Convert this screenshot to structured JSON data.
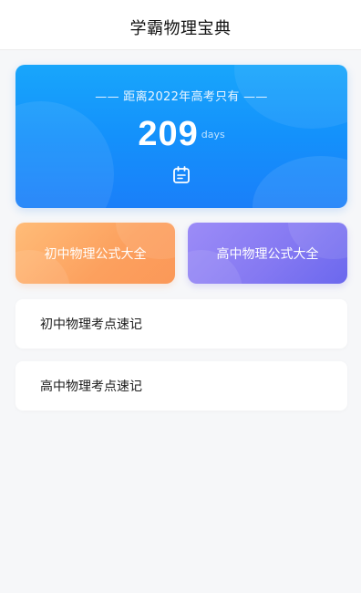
{
  "header": {
    "title": "学霸物理宝典"
  },
  "countdown": {
    "caption": "—— 距离2022年高考只有 ——",
    "days": "209",
    "unit": "days",
    "icon": "calendar-icon",
    "gradient_top": "#18a6fb",
    "gradient_bottom": "#1a7ff9"
  },
  "formula_buttons": [
    {
      "label": "初中物理公式大全",
      "color": "#fca05e"
    },
    {
      "label": "高中物理公式大全",
      "color": "#8579f2"
    }
  ],
  "quick_notes": [
    {
      "label": "初中物理考点速记"
    },
    {
      "label": "高中物理考点速记"
    }
  ]
}
